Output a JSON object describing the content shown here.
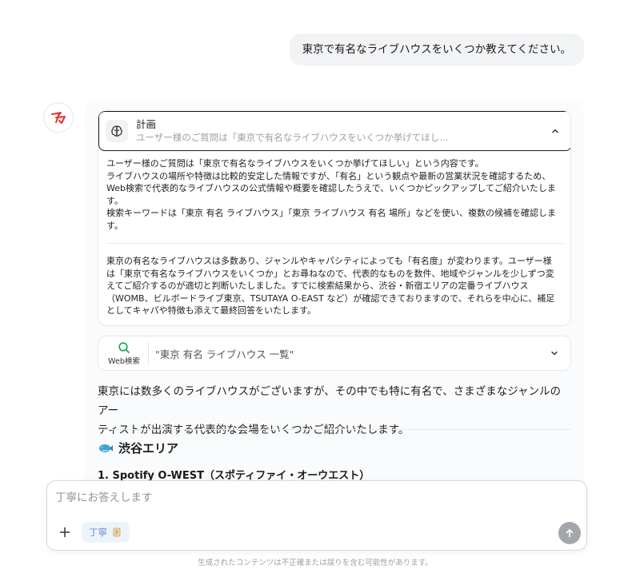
{
  "user_message": "東京で有名なライブハウスをいくつか教えてください。",
  "plan": {
    "title": "計画",
    "subtitle": "ユーザー様のご質問は「東京で有名なライブハウスをいくつか挙げてほし...",
    "paragraph1_lines": [
      "ユーザー様のご質問は「東京で有名なライブハウスをいくつか挙げてほしい」という内容です。",
      "ライブハウスの場所や特徴は比較的安定した情報ですが、「有名」という観点や最新の営業状況を確認するため、",
      "Web検索で代表的なライブハウスの公式情報や概要を確認したうえで、いくつかピックアップしてご紹介いたしま",
      "す。",
      "検索キーワードは「東京 有名 ライブハウス」「東京 ライブハウス 有名 場所」などを使い、複数の候補を確認しま",
      "す。"
    ],
    "paragraph2_lines": [
      "東京の有名なライブハウスは多数あり、ジャンルやキャパシティによっても「有名度」が変わります。ユーザー様",
      "は「東京で有名なライブハウスをいくつか」とお尋ねなので、代表的なものを数件、地域やジャンルを少しずつ変",
      "えてご紹介するのが適切と判断いたしました。すでに検索結果から、渋谷・新宿エリアの定番ライブハウス",
      "（WOMB、ビルボードライブ東京、TSUTAYA O-EAST など）が確認できておりますので、それらを中心に、補足",
      "としてキャパや特徴も添えて最終回答をいたします。"
    ]
  },
  "web_search": {
    "label": "Web検索",
    "query": "\"東京 有名 ライブハウス 一覧\""
  },
  "answer": {
    "intro_line1": "東京には数多くのライブハウスがございますが、その中でも特に有名で、さまざまなジャンルのアー",
    "intro_line2": "ティストが出演する代表的な会場をいくつかご紹介いたします。",
    "section_heading": "渋谷エリア",
    "section_icon": "fish-icon",
    "sub_heading": "1. Spotify O-WEST（スポティファイ・オーウエスト）"
  },
  "composer": {
    "placeholder": "丁寧にお答えします",
    "mode_label": "丁寧",
    "mode_icon": "scroll-icon"
  },
  "disclaimer": "生成されたコンテンツは不正確または誤りを含む可能性があります。",
  "colors": {
    "brand_red": "#e0332f",
    "mode_blue": "#6d8ccc",
    "search_green": "#17a05d",
    "send_gray": "#a3a6ab"
  }
}
